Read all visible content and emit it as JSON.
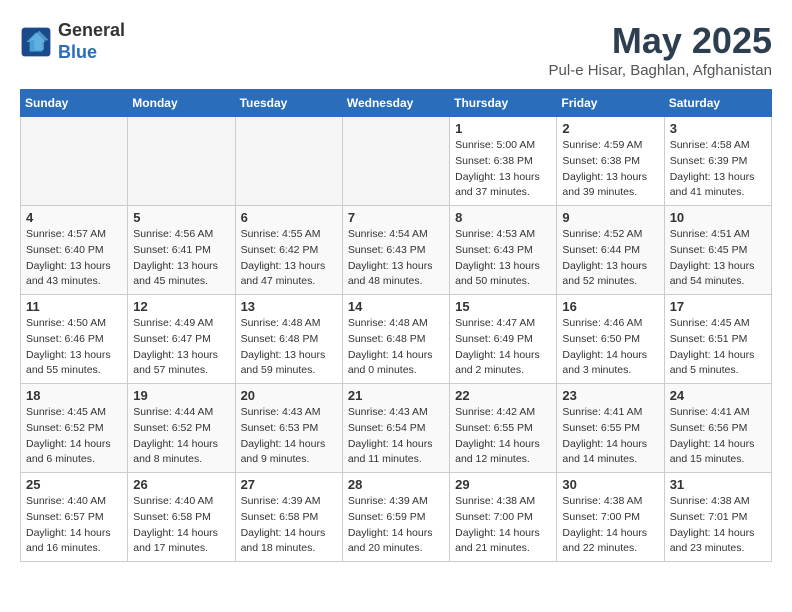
{
  "logo": {
    "general": "General",
    "blue": "Blue"
  },
  "title": {
    "month": "May 2025",
    "location": "Pul-e Hisar, Baghlan, Afghanistan"
  },
  "weekdays": [
    "Sunday",
    "Monday",
    "Tuesday",
    "Wednesday",
    "Thursday",
    "Friday",
    "Saturday"
  ],
  "weeks": [
    [
      {
        "day": "",
        "info": ""
      },
      {
        "day": "",
        "info": ""
      },
      {
        "day": "",
        "info": ""
      },
      {
        "day": "",
        "info": ""
      },
      {
        "day": "1",
        "info": "Sunrise: 5:00 AM\nSunset: 6:38 PM\nDaylight: 13 hours\nand 37 minutes."
      },
      {
        "day": "2",
        "info": "Sunrise: 4:59 AM\nSunset: 6:38 PM\nDaylight: 13 hours\nand 39 minutes."
      },
      {
        "day": "3",
        "info": "Sunrise: 4:58 AM\nSunset: 6:39 PM\nDaylight: 13 hours\nand 41 minutes."
      }
    ],
    [
      {
        "day": "4",
        "info": "Sunrise: 4:57 AM\nSunset: 6:40 PM\nDaylight: 13 hours\nand 43 minutes."
      },
      {
        "day": "5",
        "info": "Sunrise: 4:56 AM\nSunset: 6:41 PM\nDaylight: 13 hours\nand 45 minutes."
      },
      {
        "day": "6",
        "info": "Sunrise: 4:55 AM\nSunset: 6:42 PM\nDaylight: 13 hours\nand 47 minutes."
      },
      {
        "day": "7",
        "info": "Sunrise: 4:54 AM\nSunset: 6:43 PM\nDaylight: 13 hours\nand 48 minutes."
      },
      {
        "day": "8",
        "info": "Sunrise: 4:53 AM\nSunset: 6:43 PM\nDaylight: 13 hours\nand 50 minutes."
      },
      {
        "day": "9",
        "info": "Sunrise: 4:52 AM\nSunset: 6:44 PM\nDaylight: 13 hours\nand 52 minutes."
      },
      {
        "day": "10",
        "info": "Sunrise: 4:51 AM\nSunset: 6:45 PM\nDaylight: 13 hours\nand 54 minutes."
      }
    ],
    [
      {
        "day": "11",
        "info": "Sunrise: 4:50 AM\nSunset: 6:46 PM\nDaylight: 13 hours\nand 55 minutes."
      },
      {
        "day": "12",
        "info": "Sunrise: 4:49 AM\nSunset: 6:47 PM\nDaylight: 13 hours\nand 57 minutes."
      },
      {
        "day": "13",
        "info": "Sunrise: 4:48 AM\nSunset: 6:48 PM\nDaylight: 13 hours\nand 59 minutes."
      },
      {
        "day": "14",
        "info": "Sunrise: 4:48 AM\nSunset: 6:48 PM\nDaylight: 14 hours\nand 0 minutes."
      },
      {
        "day": "15",
        "info": "Sunrise: 4:47 AM\nSunset: 6:49 PM\nDaylight: 14 hours\nand 2 minutes."
      },
      {
        "day": "16",
        "info": "Sunrise: 4:46 AM\nSunset: 6:50 PM\nDaylight: 14 hours\nand 3 minutes."
      },
      {
        "day": "17",
        "info": "Sunrise: 4:45 AM\nSunset: 6:51 PM\nDaylight: 14 hours\nand 5 minutes."
      }
    ],
    [
      {
        "day": "18",
        "info": "Sunrise: 4:45 AM\nSunset: 6:52 PM\nDaylight: 14 hours\nand 6 minutes."
      },
      {
        "day": "19",
        "info": "Sunrise: 4:44 AM\nSunset: 6:52 PM\nDaylight: 14 hours\nand 8 minutes."
      },
      {
        "day": "20",
        "info": "Sunrise: 4:43 AM\nSunset: 6:53 PM\nDaylight: 14 hours\nand 9 minutes."
      },
      {
        "day": "21",
        "info": "Sunrise: 4:43 AM\nSunset: 6:54 PM\nDaylight: 14 hours\nand 11 minutes."
      },
      {
        "day": "22",
        "info": "Sunrise: 4:42 AM\nSunset: 6:55 PM\nDaylight: 14 hours\nand 12 minutes."
      },
      {
        "day": "23",
        "info": "Sunrise: 4:41 AM\nSunset: 6:55 PM\nDaylight: 14 hours\nand 14 minutes."
      },
      {
        "day": "24",
        "info": "Sunrise: 4:41 AM\nSunset: 6:56 PM\nDaylight: 14 hours\nand 15 minutes."
      }
    ],
    [
      {
        "day": "25",
        "info": "Sunrise: 4:40 AM\nSunset: 6:57 PM\nDaylight: 14 hours\nand 16 minutes."
      },
      {
        "day": "26",
        "info": "Sunrise: 4:40 AM\nSunset: 6:58 PM\nDaylight: 14 hours\nand 17 minutes."
      },
      {
        "day": "27",
        "info": "Sunrise: 4:39 AM\nSunset: 6:58 PM\nDaylight: 14 hours\nand 18 minutes."
      },
      {
        "day": "28",
        "info": "Sunrise: 4:39 AM\nSunset: 6:59 PM\nDaylight: 14 hours\nand 20 minutes."
      },
      {
        "day": "29",
        "info": "Sunrise: 4:38 AM\nSunset: 7:00 PM\nDaylight: 14 hours\nand 21 minutes."
      },
      {
        "day": "30",
        "info": "Sunrise: 4:38 AM\nSunset: 7:00 PM\nDaylight: 14 hours\nand 22 minutes."
      },
      {
        "day": "31",
        "info": "Sunrise: 4:38 AM\nSunset: 7:01 PM\nDaylight: 14 hours\nand 23 minutes."
      }
    ]
  ]
}
